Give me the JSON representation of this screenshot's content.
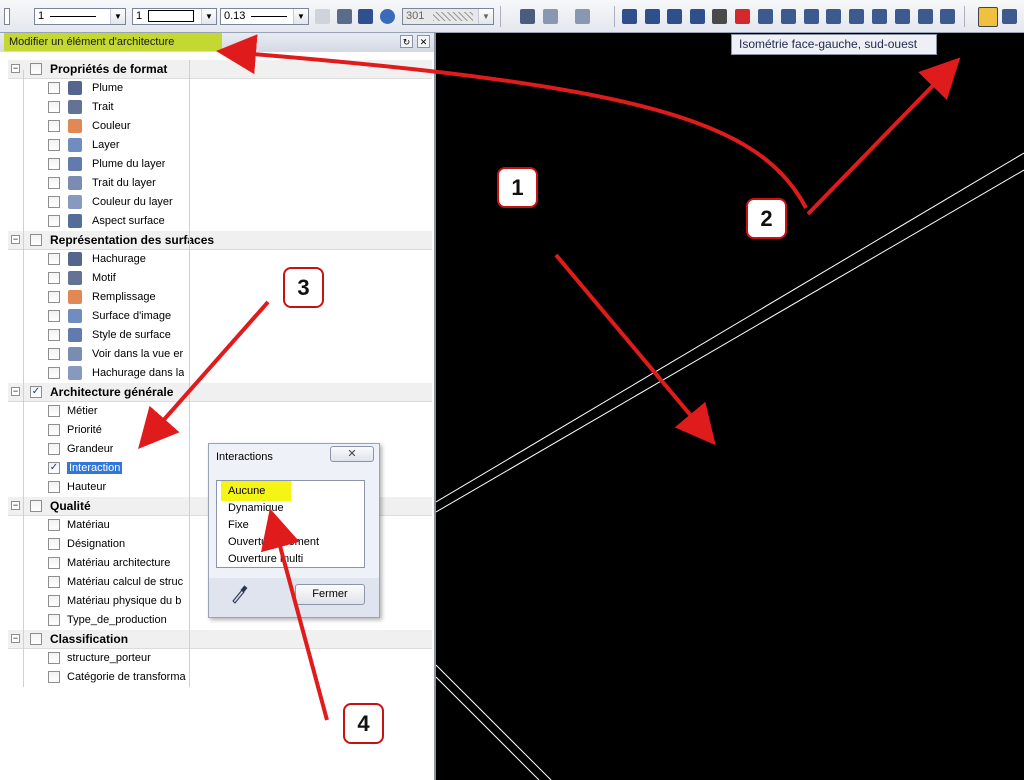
{
  "toolbar": {
    "pen_value": "1",
    "line_value": "1",
    "thickness_value": "0.13",
    "layer_number": "301"
  },
  "tooltip": "Isométrie face-gauche, sud-ouest",
  "panel": {
    "title": "Modifier un élément d'architecture",
    "groups": [
      {
        "label": "Propriétés de format",
        "items": [
          "Plume",
          "Trait",
          "Couleur",
          "Layer",
          "Plume du layer",
          "Trait du layer",
          "Couleur du layer",
          "Aspect surface"
        ]
      },
      {
        "label": "Représentation des surfaces",
        "items": [
          "Hachurage",
          "Motif",
          "Remplissage",
          "Surface d'image",
          "Style de surface",
          "Voir dans la vue er",
          "Hachurage dans la"
        ]
      },
      {
        "label": "Architecture générale",
        "items": [
          "Métier",
          "Priorité",
          "Grandeur",
          "Interaction",
          "Hauteur"
        ]
      },
      {
        "label": "Qualité",
        "items": [
          "Matériau",
          "Désignation",
          "Matériau architecture",
          "Matériau calcul de struc",
          "Matériau physique du b",
          "Type_de_production"
        ]
      },
      {
        "label": "Classification",
        "items": [
          "structure_porteur",
          "Catégorie de transforma"
        ]
      }
    ]
  },
  "dialog": {
    "title": "Interactions",
    "close_glyph": "✕",
    "options": [
      "Aucune",
      "Dynamique",
      "Fixe",
      "Ouverture élément",
      "Ouverture multi"
    ],
    "button": "Fermer"
  },
  "callouts": [
    "1",
    "2",
    "3",
    "4"
  ],
  "colors": {
    "highlight": "#c3d830",
    "arrow": "#e01b1b",
    "selection": "#3178d6",
    "dialog_highlight": "#f5f515"
  }
}
